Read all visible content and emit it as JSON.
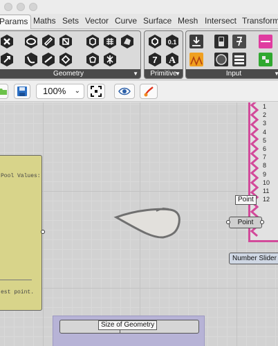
{
  "tabs": [
    "Params",
    "Maths",
    "Sets",
    "Vector",
    "Curve",
    "Surface",
    "Mesh",
    "Intersect",
    "Transform"
  ],
  "active_tab": "Params",
  "ribbon": {
    "geometry_label": "Geometry",
    "primitive_label": "Primitive",
    "input_label": "Input",
    "primitive_icons": [
      "0.1",
      "7",
      "A"
    ]
  },
  "toolbar": {
    "zoom": "100%"
  },
  "canvas": {
    "panel_line1": "Pool Values:",
    "panel_line2": "est point.",
    "point_tooltip": "Point",
    "point_label": "Point",
    "number_slider_label": "Number Slider",
    "size_tooltip": "Size of Geometry",
    "list_numbers": [
      "1",
      "2",
      "3",
      "4",
      "5",
      "6",
      "7",
      "8",
      "9",
      "10",
      "11",
      "12"
    ]
  },
  "colors": {
    "panel": "#d8d48a",
    "accent": "#d24a9a",
    "group": "#b7b3d6"
  }
}
